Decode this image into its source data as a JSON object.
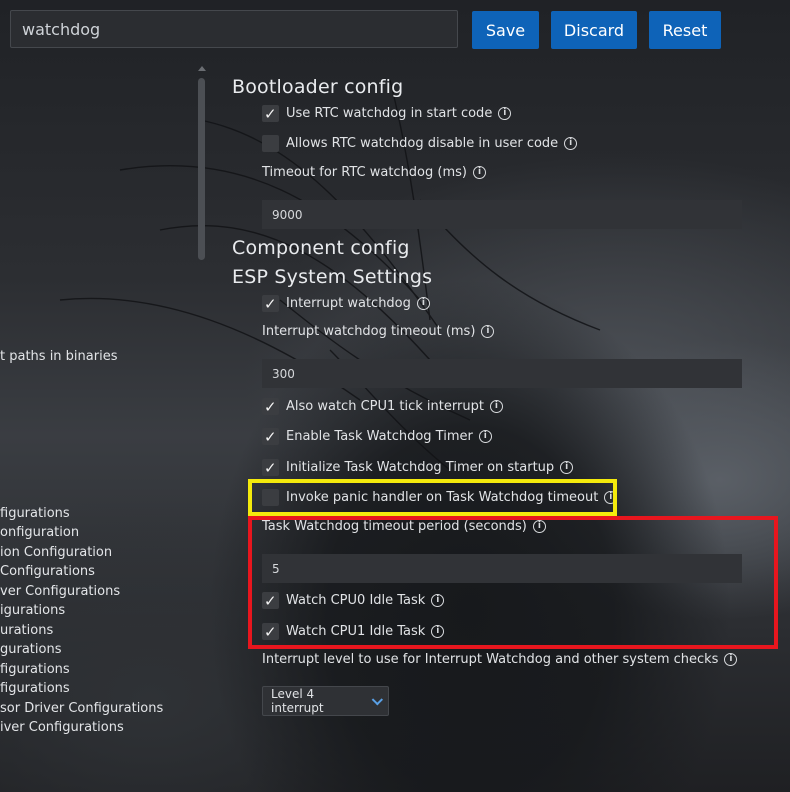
{
  "toolbar": {
    "search_value": "watchdog",
    "save_label": "Save",
    "discard_label": "Discard",
    "reset_label": "Reset",
    "button_color": "#0e63b8"
  },
  "sidebar": {
    "items": [
      "t paths in binaries",
      "figurations",
      "onfiguration",
      "ion Configuration",
      "Configurations",
      "ver Configurations",
      "igurations",
      "urations",
      "gurations",
      "figurations",
      "figurations",
      "sor Driver Configurations",
      "iver Configurations"
    ]
  },
  "main": {
    "bootloader_heading": "Bootloader config",
    "use_rtc_watchdog": "Use RTC watchdog in start code",
    "allow_rtc_disable": "Allows RTC watchdog disable in user code",
    "rtc_timeout_label": "Timeout for RTC watchdog (ms)",
    "rtc_timeout_value": "9000",
    "component_heading": "Component config",
    "esp_system_heading": "ESP System Settings",
    "interrupt_watchdog": "Interrupt watchdog",
    "int_wdt_timeout_label": "Interrupt watchdog timeout (ms)",
    "int_wdt_timeout_value": "300",
    "watch_cpu1_tick": "Also watch CPU1 tick interrupt",
    "enable_task_wdt": "Enable Task Watchdog Timer",
    "init_task_wdt": "Initialize Task Watchdog Timer on startup",
    "invoke_panic": "Invoke panic handler on Task Watchdog timeout",
    "task_wdt_timeout_label": "Task Watchdog timeout period (seconds)",
    "task_wdt_timeout_value": "5",
    "watch_cpu0_idle": "Watch CPU0 Idle Task",
    "watch_cpu1_idle": "Watch CPU1 Idle Task",
    "interrupt_level_label": "Interrupt level to use for Interrupt Watchdog and other system checks",
    "interrupt_level_value": "Level 4 interrupt",
    "info_glyph": "i"
  },
  "highlights": {
    "yellow": "#f4ea0c",
    "red": "#e8161e"
  }
}
